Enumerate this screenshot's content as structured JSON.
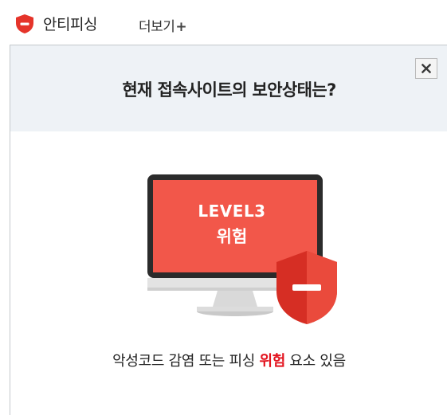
{
  "tab": {
    "title": "안티피싱",
    "more_label": "더보기",
    "more_plus": "+",
    "icon": "minus-shield-icon"
  },
  "panel": {
    "headline": "현재 접속사이트의 보안상태는?",
    "close_label": "×",
    "level_text": "LEVEL3",
    "level_risk": "위험",
    "message_prefix": "악성코드 감염 또는 피싱 ",
    "message_danger": "위험",
    "message_suffix": " 요소 있음"
  },
  "colors": {
    "danger_red": "#e3141f",
    "screen_red": "#f2574a",
    "shield_red": "#e8392f",
    "header_bg": "#eef2f6"
  }
}
